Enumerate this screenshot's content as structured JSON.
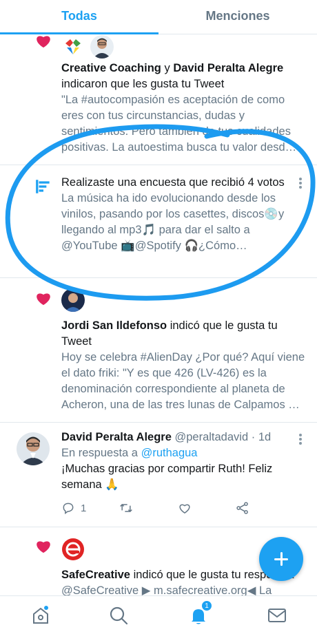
{
  "tabs": {
    "all": "Todas",
    "mentions": "Menciones"
  },
  "notifications": [
    {
      "type": "like",
      "actor1": "Creative Coaching",
      "joiner": "y",
      "actor2": "David Peralta Alegre",
      "action": "indicaron que les gusta tu Tweet",
      "snippet": "\"La #autocompasión es aceptación de como eres con tus circunstancias, dudas y sentimientos. Pero también de tus cualidades positivas. La autoestima busca tu valor desd…"
    },
    {
      "type": "poll",
      "text": "Realizaste una encuesta que recibió 4 votos",
      "snippet": "La música ha ido evolucionando desde los vinilos, pasando por los casettes, discos💿y llegando al mp3🎵 para dar el salto a @YouTube 📺@Spotify 🎧¿Cómo…"
    },
    {
      "type": "like",
      "actor": "Jordi San Ildefonso",
      "action": "indicó que le gusta tu Tweet",
      "snippet": "Hoy se celebra #AlienDay ¿Por qué? Aquí viene el dato friki: \"Y es que 426 (LV-426) es la denominación correspondiente al planeta de Acheron, una de las tres lunas de Calpamos …"
    },
    {
      "type": "reply",
      "name": "David Peralta Alegre",
      "handle": "@peraltadavid",
      "dot": "·",
      "time": "1d",
      "reply_prefix": "En respuesta a",
      "reply_to": "@ruthagua",
      "text": "¡Muchas gracias por compartir Ruth! Feliz semana 🙏",
      "reply_count": "1"
    },
    {
      "type": "like",
      "actor": "SafeCreative",
      "action": "indicó que le gusta tu respuesta",
      "snippet": "@SafeCreative ▶ m.safecreative.org◀ La"
    }
  ],
  "bottom_nav": {
    "notifications_badge": "1"
  },
  "colors": {
    "accent": "#1da1f2",
    "like": "#e0245e",
    "muted": "#657786",
    "annotation": "#1d9bf0"
  },
  "icons": [
    "heart-icon",
    "poll-icon",
    "more-icon",
    "reply-icon",
    "retweet-icon",
    "like-icon",
    "share-icon",
    "home-icon",
    "search-icon",
    "bell-icon",
    "mail-icon",
    "compose-icon"
  ]
}
